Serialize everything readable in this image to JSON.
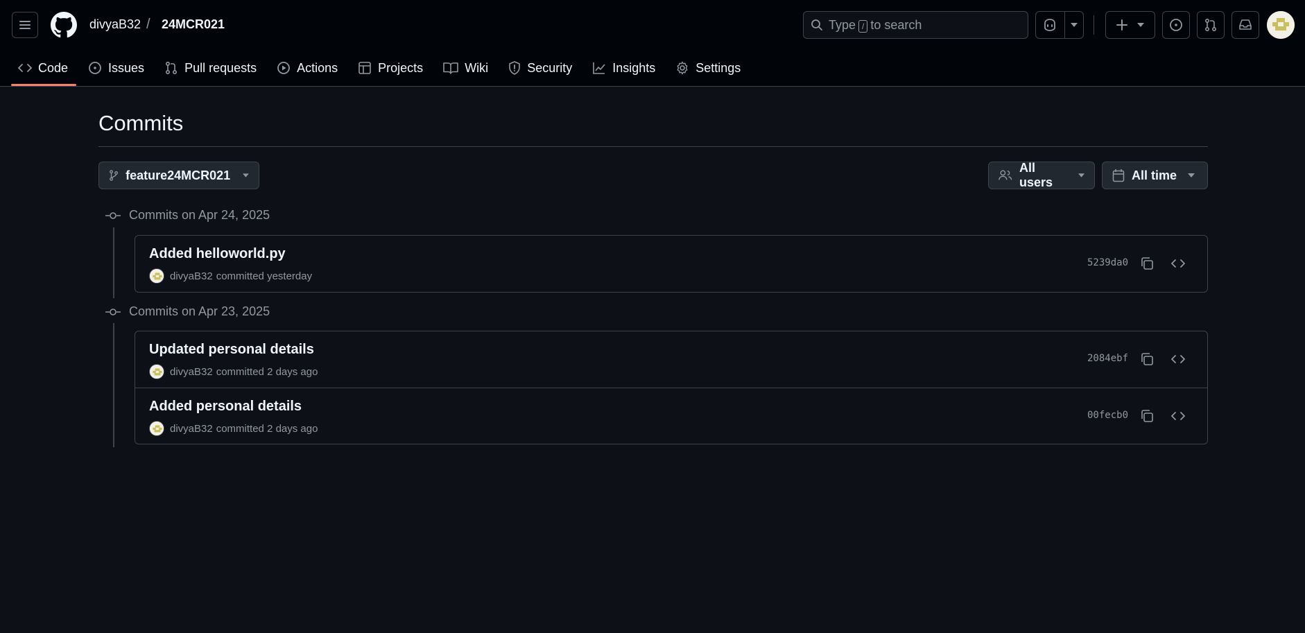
{
  "header": {
    "owner": "divyaB32",
    "separator": "/",
    "repo": "24MCR021",
    "search": {
      "prefix": "Type",
      "key": "/",
      "suffix": "to search"
    }
  },
  "nav": [
    {
      "label": "Code",
      "icon": "code-icon"
    },
    {
      "label": "Issues",
      "icon": "issue-icon"
    },
    {
      "label": "Pull requests",
      "icon": "pull-request-icon"
    },
    {
      "label": "Actions",
      "icon": "play-icon"
    },
    {
      "label": "Projects",
      "icon": "table-icon"
    },
    {
      "label": "Wiki",
      "icon": "book-icon"
    },
    {
      "label": "Security",
      "icon": "shield-icon"
    },
    {
      "label": "Insights",
      "icon": "graph-icon"
    },
    {
      "label": "Settings",
      "icon": "gear-icon"
    }
  ],
  "page": {
    "title": "Commits",
    "branch": "feature24MCR021",
    "users_filter": "All users",
    "time_filter": "All time"
  },
  "groups": [
    {
      "heading": "Commits on Apr 24, 2025",
      "commits": [
        {
          "title": "Added helloworld.py",
          "author": "divyaB32",
          "meta": "committed yesterday",
          "sha": "5239da0"
        }
      ]
    },
    {
      "heading": "Commits on Apr 23, 2025",
      "commits": [
        {
          "title": "Updated personal details",
          "author": "divyaB32",
          "meta": "committed 2 days ago",
          "sha": "2084ebf"
        },
        {
          "title": "Added personal details",
          "author": "divyaB32",
          "meta": "committed 2 days ago",
          "sha": "00fecb0"
        }
      ]
    }
  ],
  "colors": {
    "background": "#0d1117",
    "header": "#010409",
    "border": "#3d444d",
    "text": "#f0f6fc",
    "muted": "#9198a1"
  }
}
